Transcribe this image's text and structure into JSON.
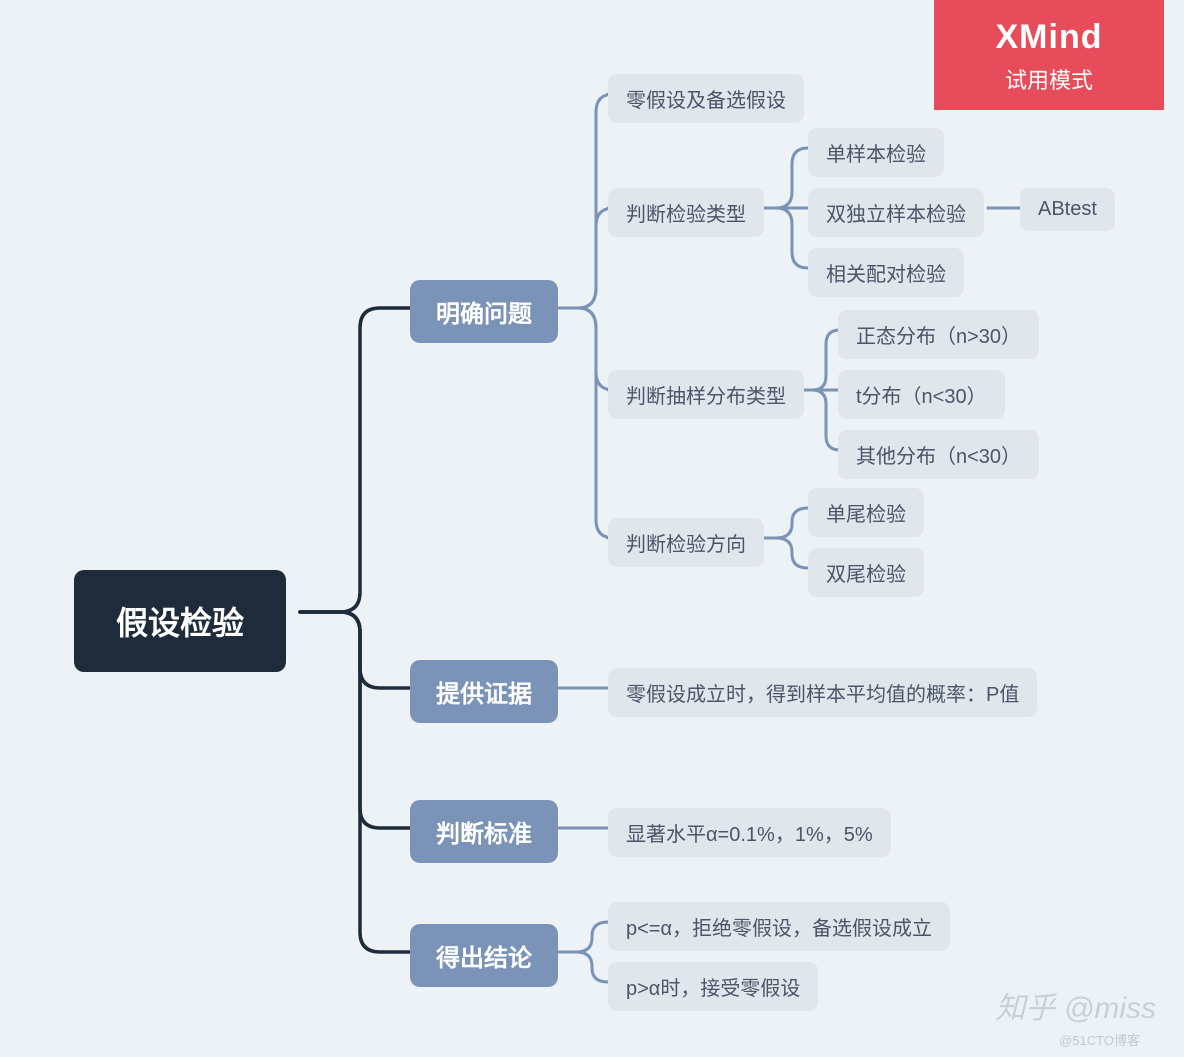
{
  "watermark": {
    "brand": "XMind",
    "mode": "试用模式",
    "zhihu": "知乎 @miss",
    "cto": "@51CTO博客"
  },
  "root": {
    "label": "假设检验"
  },
  "branches": {
    "b1": {
      "label": "明确问题"
    },
    "b2": {
      "label": "提供证据"
    },
    "b3": {
      "label": "判断标准"
    },
    "b4": {
      "label": "得出结论"
    }
  },
  "b1_children": {
    "c1": {
      "label": "零假设及备选假设"
    },
    "c2": {
      "label": "判断检验类型"
    },
    "c3": {
      "label": "判断抽样分布类型"
    },
    "c4": {
      "label": "判断检验方向"
    }
  },
  "b1_c2_children": {
    "d1": {
      "label": "单样本检验"
    },
    "d2": {
      "label": "双独立样本检验"
    },
    "d3": {
      "label": "相关配对检验"
    }
  },
  "b1_c2_d2_child": {
    "label": "ABtest"
  },
  "b1_c3_children": {
    "d1": {
      "label": "正态分布（n>30）"
    },
    "d2": {
      "label": "t分布（n<30）"
    },
    "d3": {
      "label": "其他分布（n<30）"
    }
  },
  "b1_c4_children": {
    "d1": {
      "label": "单尾检验"
    },
    "d2": {
      "label": "双尾检验"
    }
  },
  "b2_child": {
    "label": "零假设成立时，得到样本平均值的概率：P值"
  },
  "b3_child": {
    "label": "显著水平α=0.1%，1%，5%"
  },
  "b4_children": {
    "d1": {
      "label": "p<=α，拒绝零假设，备选假设成立"
    },
    "d2": {
      "label": "p>α时，接受零假设"
    }
  }
}
